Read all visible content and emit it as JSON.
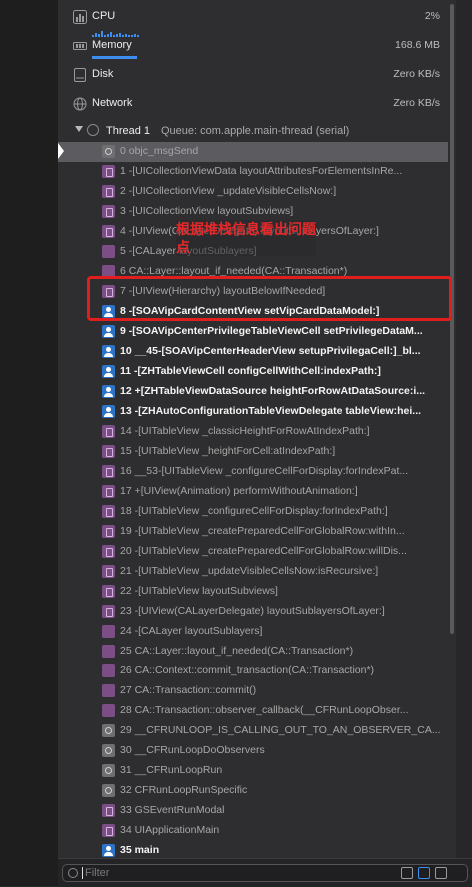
{
  "gauges": {
    "cpu": {
      "label": "CPU",
      "value": "2%"
    },
    "memory": {
      "label": "Memory",
      "value": "168.6 MB"
    },
    "disk": {
      "label": "Disk",
      "value": "Zero KB/s"
    },
    "network": {
      "label": "Network",
      "value": "Zero KB/s"
    }
  },
  "thread": {
    "label": "Thread 1",
    "queue": "Queue: com.apple.main-thread (serial)"
  },
  "frames": [
    {
      "text": "0 objc_msgSend",
      "kind": "gear",
      "user": false
    },
    {
      "text": "1 -[UICollectionViewData layoutAttributesForElementsInRe...",
      "kind": "sys",
      "user": false
    },
    {
      "text": "2 -[UICollectionView _updateVisibleCellsNow:]",
      "kind": "sys",
      "user": false
    },
    {
      "text": "3 -[UICollectionView layoutSubviews]",
      "kind": "sys",
      "user": false
    },
    {
      "text": "4 -[UIView(CALayerDelegate) layoutSublayersOfLayer:]",
      "kind": "sys",
      "user": false
    },
    {
      "text": "5 -[CALayer layoutSublayers]",
      "kind": "cup",
      "user": false
    },
    {
      "text": "6 CA::Layer::layout_if_needed(CA::Transaction*)",
      "kind": "cup",
      "user": false
    },
    {
      "text": "7 -[UIView(Hierarchy) layoutBelowIfNeeded]",
      "kind": "sys",
      "user": false
    },
    {
      "text": "8 -[SOAVipCardContentView setVipCardDataModel:]",
      "kind": "usr",
      "user": true
    },
    {
      "text": "9 -[SOAVipCenterPrivilegeTableViewCell setPrivilegeDataM...",
      "kind": "usr",
      "user": true
    },
    {
      "text": "10 __45-[SOAVipCenterHeaderView setupPrivilegaCell:]_bl...",
      "kind": "usr",
      "user": true
    },
    {
      "text": "11 -[ZHTableViewCell configCellWithCell:indexPath:]",
      "kind": "usr",
      "user": true
    },
    {
      "text": "12 +[ZHTableViewDataSource heightForRowAtDataSource:i...",
      "kind": "usr",
      "user": true
    },
    {
      "text": "13 -[ZHAutoConfigurationTableViewDelegate tableView:hei...",
      "kind": "usr",
      "user": true
    },
    {
      "text": "14 -[UITableView _classicHeightForRowAtIndexPath:]",
      "kind": "sys",
      "user": false
    },
    {
      "text": "15 -[UITableView _heightForCell:atIndexPath:]",
      "kind": "sys",
      "user": false
    },
    {
      "text": "16 __53-[UITableView _configureCellForDisplay:forIndexPat...",
      "kind": "sys",
      "user": false
    },
    {
      "text": "17 +[UIView(Animation) performWithoutAnimation:]",
      "kind": "sys",
      "user": false
    },
    {
      "text": "18 -[UITableView _configureCellForDisplay:forIndexPath:]",
      "kind": "sys",
      "user": false
    },
    {
      "text": "19 -[UITableView _createPreparedCellForGlobalRow:withIn...",
      "kind": "sys",
      "user": false
    },
    {
      "text": "20 -[UITableView _createPreparedCellForGlobalRow:willDis...",
      "kind": "sys",
      "user": false
    },
    {
      "text": "21 -[UITableView _updateVisibleCellsNow:isRecursive:]",
      "kind": "sys",
      "user": false
    },
    {
      "text": "22 -[UITableView layoutSubviews]",
      "kind": "sys",
      "user": false
    },
    {
      "text": "23 -[UIView(CALayerDelegate) layoutSublayersOfLayer:]",
      "kind": "sys",
      "user": false
    },
    {
      "text": "24 -[CALayer layoutSublayers]",
      "kind": "cup",
      "user": false
    },
    {
      "text": "25 CA::Layer::layout_if_needed(CA::Transaction*)",
      "kind": "cup",
      "user": false
    },
    {
      "text": "26 CA::Context::commit_transaction(CA::Transaction*)",
      "kind": "cup",
      "user": false
    },
    {
      "text": "27 CA::Transaction::commit()",
      "kind": "cup",
      "user": false
    },
    {
      "text": "28 CA::Transaction::observer_callback(__CFRunLoopObser...",
      "kind": "cup",
      "user": false
    },
    {
      "text": "29 __CFRUNLOOP_IS_CALLING_OUT_TO_AN_OBSERVER_CA...",
      "kind": "gear",
      "user": false
    },
    {
      "text": "30 __CFRunLoopDoObservers",
      "kind": "gear",
      "user": false
    },
    {
      "text": "31 __CFRunLoopRun",
      "kind": "gear",
      "user": false
    },
    {
      "text": "32 CFRunLoopRunSpecific",
      "kind": "gear",
      "user": false
    },
    {
      "text": "33 GSEventRunModal",
      "kind": "sys",
      "user": false
    },
    {
      "text": "34 UIApplicationMain",
      "kind": "sys",
      "user": false
    },
    {
      "text": "35 main",
      "kind": "usr",
      "user": true
    }
  ],
  "selected_frame": 0,
  "annotation": {
    "text": "根据堆栈信息看出问题点"
  },
  "filter": {
    "placeholder": "Filter"
  },
  "colors": {
    "accent": "#3d8ef0",
    "annotation_red": "#e01e1e",
    "user_frame_icon": "#2d73c7",
    "system_frame_icon": "#7b4f86"
  }
}
